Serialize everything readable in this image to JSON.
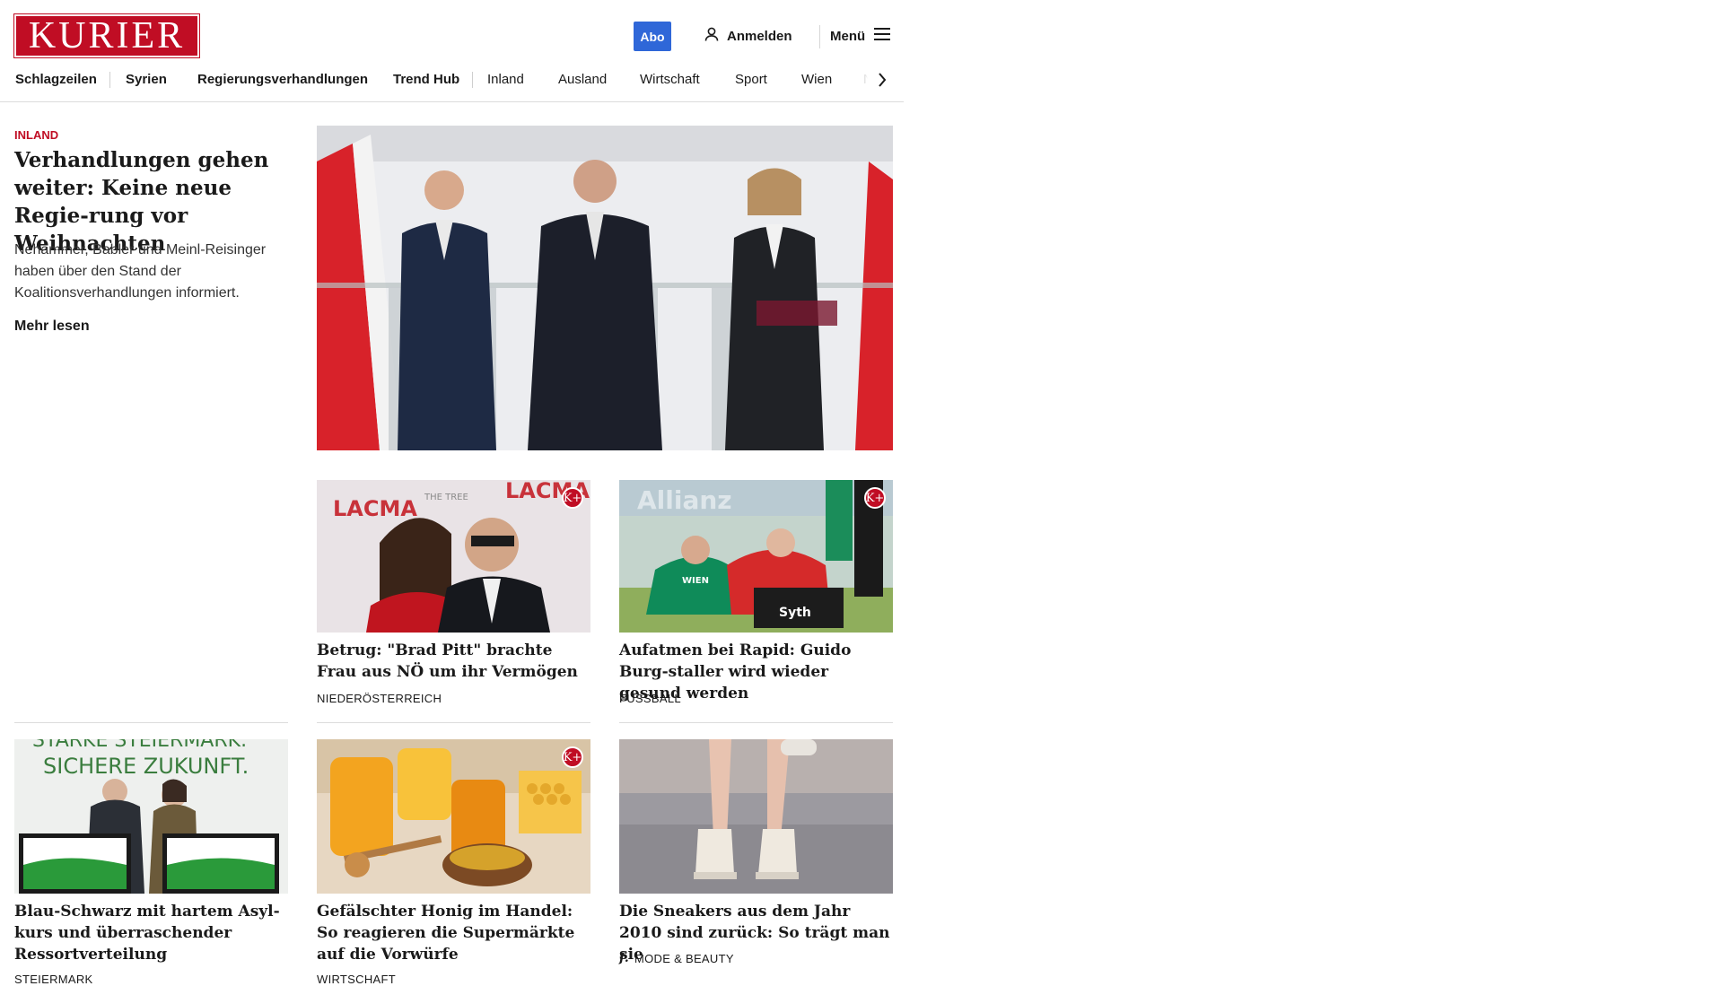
{
  "brand": {
    "logo_text": "KURIER",
    "accent": "#c00d24",
    "abo_color": "#2f67d8"
  },
  "header": {
    "abo_label": "Abo",
    "login_label": "Anmelden",
    "menu_label": "Menü"
  },
  "nav": {
    "items": [
      {
        "label": "Schlagzeilen",
        "bold": true
      },
      {
        "label": "Syrien",
        "bold": true
      },
      {
        "label": "Regierungsverhandlungen",
        "bold": true
      },
      {
        "label": "Trend Hub",
        "bold": true
      },
      {
        "label": "Inland",
        "bold": false
      },
      {
        "label": "Ausland",
        "bold": false
      },
      {
        "label": "Wirtschaft",
        "bold": false
      },
      {
        "label": "Sport",
        "bold": false
      },
      {
        "label": "Wien",
        "bold": false
      },
      {
        "label": "NÖ",
        "bold": false
      }
    ]
  },
  "lead": {
    "kicker": "INLAND",
    "title": "Verhandlungen gehen weiter: Keine neue Regie-rung vor Weihnachten",
    "teaser": "Nehammer, Babler und Meinl-Reisinger haben über den Stand der Koalitionsverhandlungen informiert.",
    "more_label": "Mehr lesen"
  },
  "cards": [
    {
      "title": "Betrug: \"Brad Pitt\" brachte Frau aus NÖ um ihr Vermögen",
      "kicker": "NIEDERÖSTERREICH",
      "premium": true,
      "premium_label": "K+"
    },
    {
      "title": "Aufatmen bei Rapid: Guido Burg-staller wird wieder gesund werden",
      "kicker": "FUSSBALL",
      "premium": true,
      "premium_label": "K+"
    },
    {
      "title": "Blau-Schwarz mit hartem Asyl-kurs und überraschender Ressortverteilung",
      "kicker": "STEIERMARK",
      "premium": false
    },
    {
      "title": "Gefälschter Honig im Handel: So reagieren die Supermärkte auf die Vorwürfe",
      "kicker": "WIRTSCHAFT",
      "premium": true,
      "premium_label": "K+"
    },
    {
      "title": "Die Sneakers aus dem Jahr 2010 sind zurück: So trägt man sie",
      "kicker": "MODE & BEAUTY",
      "premium": false,
      "kicker_icon": "freizeit-f-icon",
      "kicker_icon_text": "f."
    }
  ],
  "image_text": {
    "lacma": "LACMA",
    "the_tree": "THE TREE",
    "steiermark_banner_1": "STARKE STEIERMARK.",
    "steiermark_banner_2": "SICHERE ZUKUNFT.",
    "rapid_bag": "Syth",
    "rapid_shirt": "WIEN",
    "rapid_sponsor": "Allianz"
  }
}
